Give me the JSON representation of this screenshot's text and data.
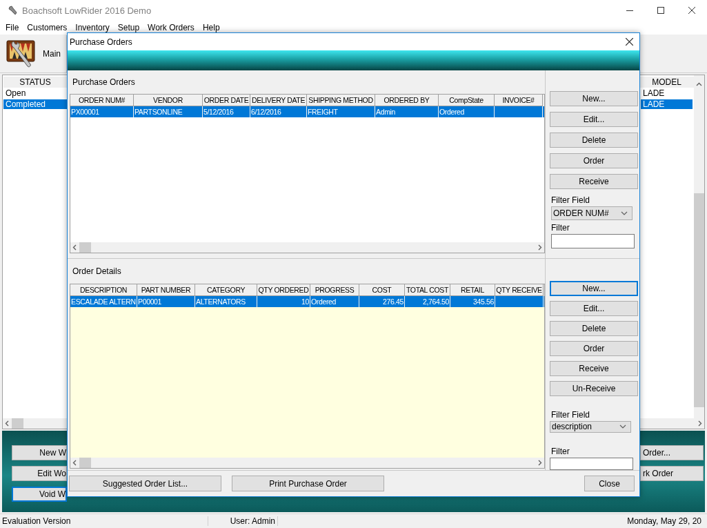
{
  "window": {
    "title": "Boachsoft LowRider 2016 Demo"
  },
  "menu": [
    "File",
    "Customers",
    "Inventory",
    "Setup",
    "Work Orders",
    "Help"
  ],
  "toolbar": [
    {
      "label": "Main"
    }
  ],
  "status_table": {
    "columns": [
      "STATUS"
    ],
    "rows": [
      {
        "cells": [
          "Open"
        ],
        "selected": false
      },
      {
        "cells": [
          "Completed"
        ],
        "selected": true
      }
    ]
  },
  "model_table": {
    "columns": [
      "MODEL"
    ],
    "rows": [
      {
        "cells": [
          "LADE"
        ],
        "selected": false
      },
      {
        "cells": [
          "LADE"
        ],
        "selected": true
      }
    ]
  },
  "left_buttons": [
    {
      "label": "New W",
      "focused": false
    },
    {
      "label": "Edit Wo",
      "focused": false
    },
    {
      "label": "Void W",
      "focused": true
    }
  ],
  "right_buttons": [
    {
      "label": "Order...",
      "focused": false
    },
    {
      "label": "rk Order",
      "focused": false
    }
  ],
  "status_bar": [
    "Evaluation Version",
    "User: Admin",
    "Monday, May 29, 20"
  ],
  "dialog": {
    "title": "Purchase Orders",
    "purchase_orders": {
      "label": "Purchase Orders",
      "columns": [
        "ORDER NUM#",
        "VENDOR",
        "ORDER DATE",
        "DELIVERY DATE",
        "SHIPPING METHOD",
        "ORDERED BY",
        "CompState",
        "INVOICE#"
      ],
      "rows": [
        {
          "cells": [
            "PX00001",
            "PARTSONLINE",
            "5/12/2016",
            "6/12/2016",
            "FREIGHT",
            "Admin",
            "Ordered",
            ""
          ],
          "selected": true
        }
      ]
    },
    "po_buttons": [
      {
        "label": "New...",
        "focused": false
      },
      {
        "label": "Edit...",
        "focused": false
      },
      {
        "label": "Delete",
        "focused": false
      },
      {
        "label": "Order",
        "focused": false
      },
      {
        "label": "Receive",
        "focused": false
      }
    ],
    "po_filter": {
      "field_label": "Filter Field",
      "field_value": "ORDER NUM#",
      "filter_label": "Filter"
    },
    "order_details": {
      "label": "Order Details",
      "columns": [
        "DESCRIPTION",
        "PART NUMBER",
        "CATEGORY",
        "QTY ORDERED",
        "PROGRESS",
        "COST",
        "TOTAL COST",
        "RETAIL",
        "QTY RECEIVE"
      ],
      "rows": [
        {
          "cells": [
            "ESCALADE ALTERN",
            "P00001",
            "ALTERNATORS",
            "10",
            "Ordered",
            "276.45",
            "2,764.50",
            "345.56",
            ""
          ],
          "selected": true
        }
      ]
    },
    "od_buttons": [
      {
        "label": "New...",
        "focused": true
      },
      {
        "label": "Edit...",
        "focused": false
      },
      {
        "label": "Delete",
        "focused": false
      },
      {
        "label": "Order",
        "focused": false
      },
      {
        "label": "Receive",
        "focused": false
      },
      {
        "label": "Un-Receive",
        "focused": false
      }
    ],
    "od_filter": {
      "field_label": "Filter Field",
      "field_value": "description",
      "filter_label": "Filter"
    },
    "bottom_buttons": [
      "Suggested Order List...",
      "Print Purchase Order"
    ],
    "close_button": "Close"
  }
}
